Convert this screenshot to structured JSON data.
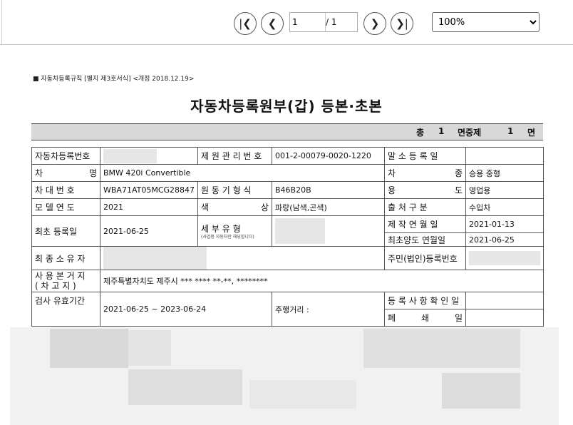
{
  "viewer": {
    "page_current": "1",
    "page_total": "/ 1",
    "zoom": "100%",
    "zoom_options": [
      "100%"
    ],
    "first_icon": "first-page-icon",
    "prev_icon": "prev-page-icon",
    "next_icon": "next-page-icon",
    "last_icon": "last-page-icon"
  },
  "document": {
    "regulation": "■ 자동차등록규칙 [별지 제3호서식]  <개정 2018.12.19>",
    "title": "자동차등록원부(갑) 등본·초본",
    "page_info": {
      "total_label": "총",
      "total": "1",
      "of_label": "면중제",
      "page": "1",
      "page_label": "면"
    },
    "rows": {
      "reg_no_label": "자동차등록번호",
      "mgmt_no_label": "제 원 관 리 번 호",
      "mgmt_no": "001-2-00079-0020-1220",
      "cancel_date_label": "말 소 등 록 일",
      "car_name_label": "차 명",
      "car_name": "BMW 420i Convertible",
      "car_type_label": "차 종",
      "car_type": "승용 중형",
      "vin_label": "차 대 번 호",
      "vin": "WBA71AT05MCG28847",
      "engine_label": "원 동 기 형 식",
      "engine": "B46B20B",
      "usage_label": "용 도",
      "usage": "영업용",
      "model_year_label": "모 델 연 도",
      "model_year": "2021",
      "color_label": "색 상",
      "color": "파랑(남색,곤색)",
      "origin_label": "출 처 구 분",
      "origin": "수입차",
      "first_reg_label": "최초 등록일",
      "first_reg": "2021-06-25",
      "detail_type_label": "세 부 유 형",
      "detail_note": "(사업용 자동차만 해당합니다)",
      "manuf_date_label": "제 작 연 월 일",
      "manuf_date": "2021-01-13",
      "first_transfer_label": "최초양도 연월일",
      "first_transfer": "2021-06-25",
      "last_owner_label": "최 종 소 유 자",
      "resident_no_label": "주민(법인)등록번호",
      "base_location_label_1": "사 용 본 거 지",
      "base_location_label_2": "( 차 고 지 )",
      "base_location": "제주특별자치도 제주시 *** **** **-**, ********",
      "inspection_label": "검사 유효기간",
      "inspection": "2021-06-25 ~ 2023-06-24",
      "mileage_label": "주행거리 :",
      "confirm_date_label": "등 록 사 항 확 인 일",
      "closed_label": "폐 쇄 일"
    }
  }
}
